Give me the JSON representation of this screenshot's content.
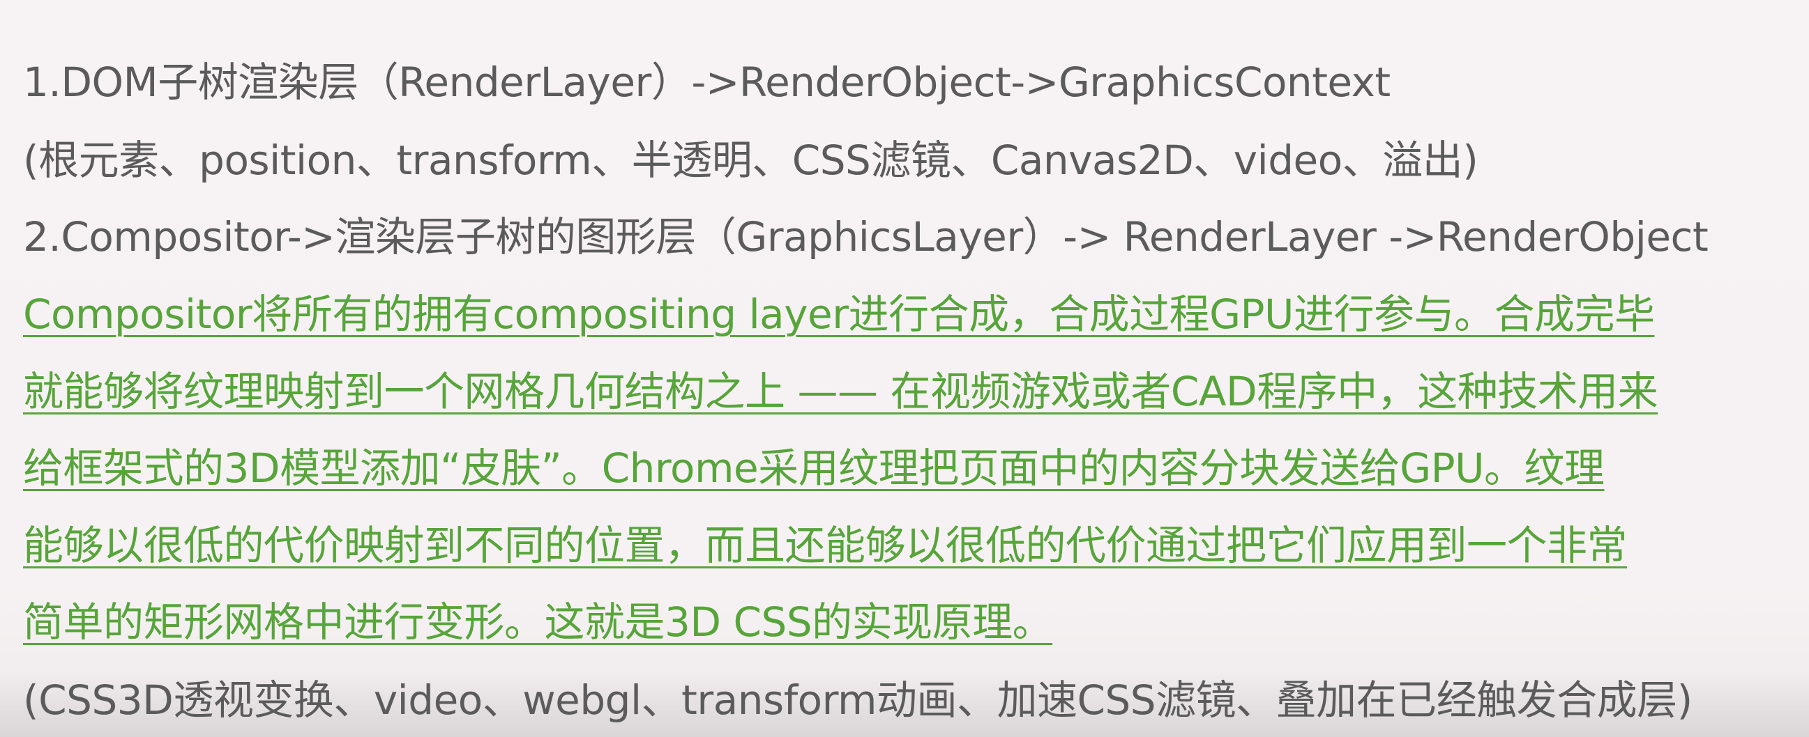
{
  "lines": [
    "1.DOM子树渲染层（RenderLayer）->RenderObject->GraphicsContext",
    "(根元素、position、transform、半透明、CSS滤镜、Canvas2D、video、溢出)",
    "2.Compositor->渲染层子树的图形层（GraphicsLayer）-> RenderLayer ->RenderObject",
    "Compositor将所有的拥有compositing layer进行合成，合成过程GPU进行参与。合成完毕",
    "就能够将纹理映射到一个网格几何结构之上 —— 在视频游戏或者CAD程序中，这种技术用来",
    "给框架式的3D模型添加“皮肤”。Chrome采用纹理把页面中的内容分块发送给GPU。纹理",
    "能够以很低的代价映射到不同的位置，而且还能够以很低的代价通过把它们应用到一个非常",
    "简单的矩形网格中进行变形。这就是3D CSS的实现原理。",
    "(CSS3D透视变换、video、webgl、transform动画、加速CSS滤镜、叠加在已经触发合成层)"
  ],
  "colors": {
    "normal_text": "#5b5b5b",
    "highlight_text": "#57a53a",
    "background": "#f6f2f3"
  }
}
